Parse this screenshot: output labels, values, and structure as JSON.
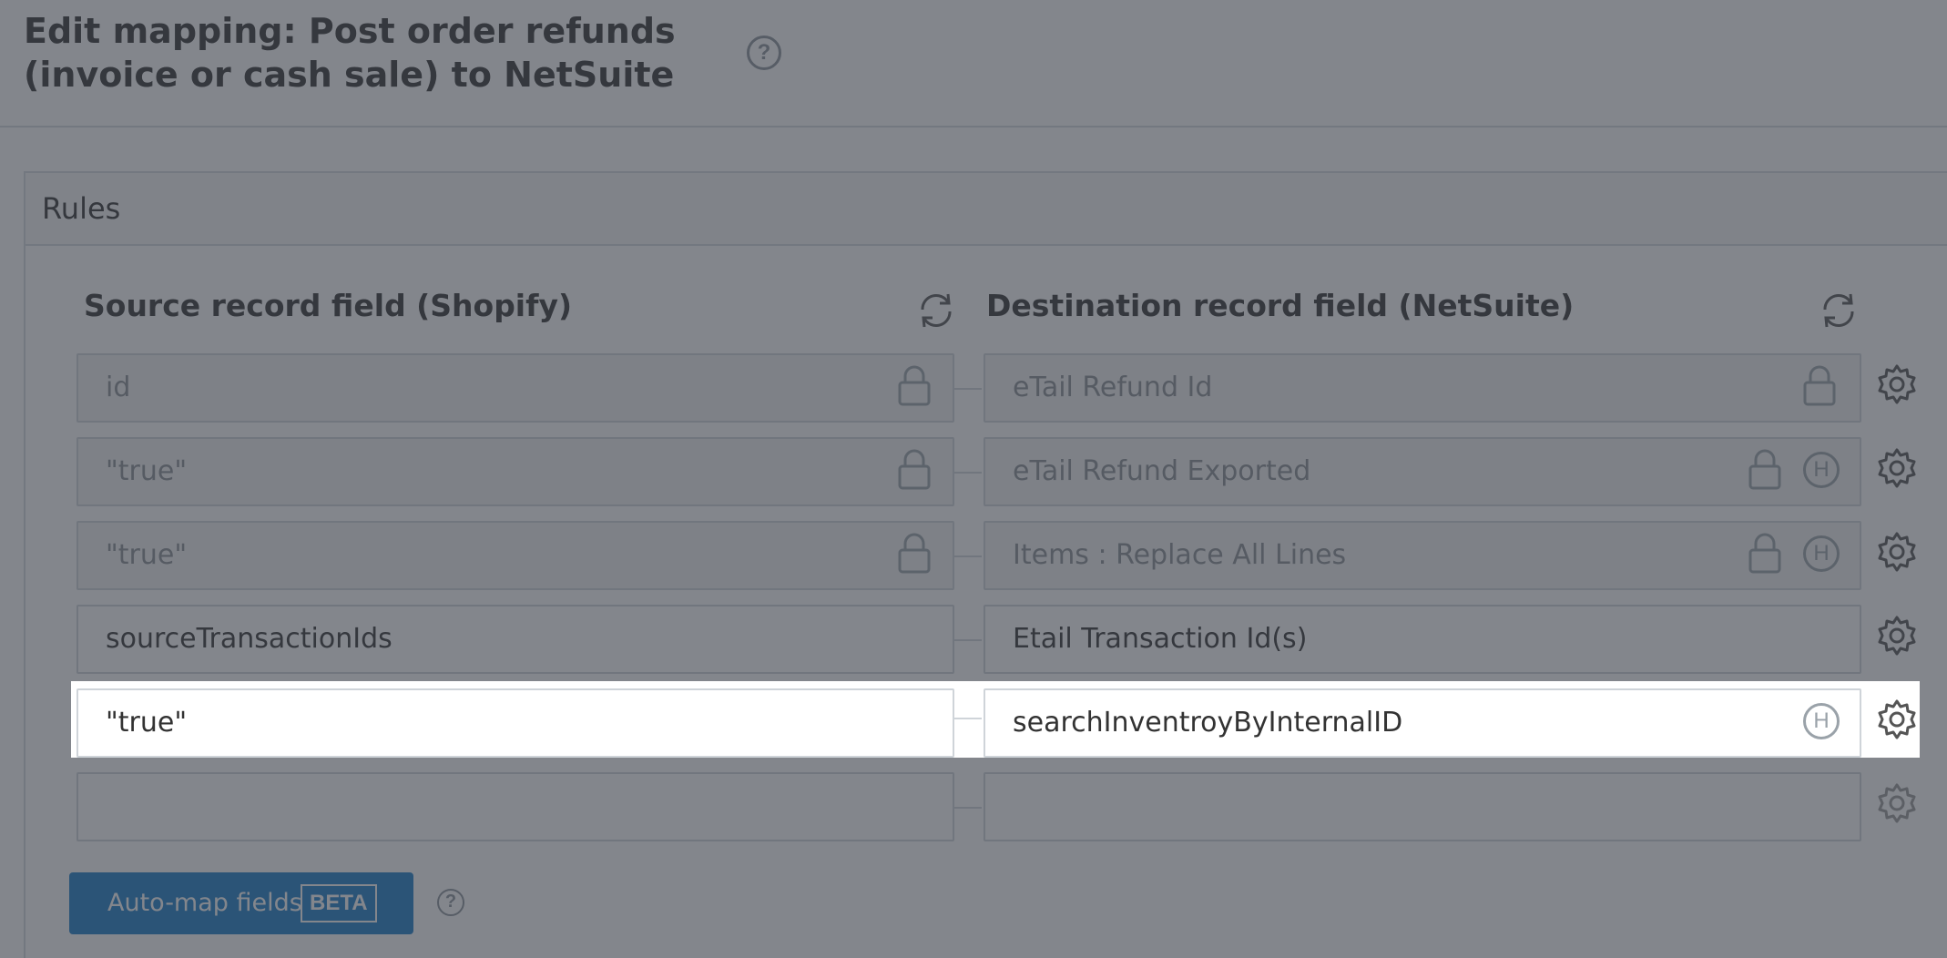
{
  "header": {
    "title": "Edit mapping: Post order refunds (invoice or cash sale) to NetSuite"
  },
  "rules": {
    "title": "Rules"
  },
  "columns": {
    "source_title": "Source record field (Shopify)",
    "destination_title": "Destination record field (NetSuite)"
  },
  "rows": [
    {
      "source": "id",
      "destination": "eTail Refund Id",
      "locked": true,
      "h_badge": false
    },
    {
      "source": "\"true\"",
      "destination": "eTail Refund Exported",
      "locked": true,
      "h_badge": true
    },
    {
      "source": "\"true\"",
      "destination": "Items : Replace All Lines",
      "locked": true,
      "h_badge": true
    },
    {
      "source": "sourceTransactionIds",
      "destination": "Etail Transaction Id(s)",
      "locked": false,
      "h_badge": false
    },
    {
      "source": "\"true\"",
      "destination": "searchInventroyByInternalID",
      "locked": false,
      "h_badge": true
    },
    {
      "source": "",
      "destination": "",
      "locked": false,
      "h_badge": false
    }
  ],
  "badges": {
    "h_label": "H",
    "help_label": "?"
  },
  "automap": {
    "label": "Auto-map fields",
    "badge": "BETA"
  },
  "colors": {
    "accent": "#1a7cc9",
    "overlay": "#373c46"
  }
}
